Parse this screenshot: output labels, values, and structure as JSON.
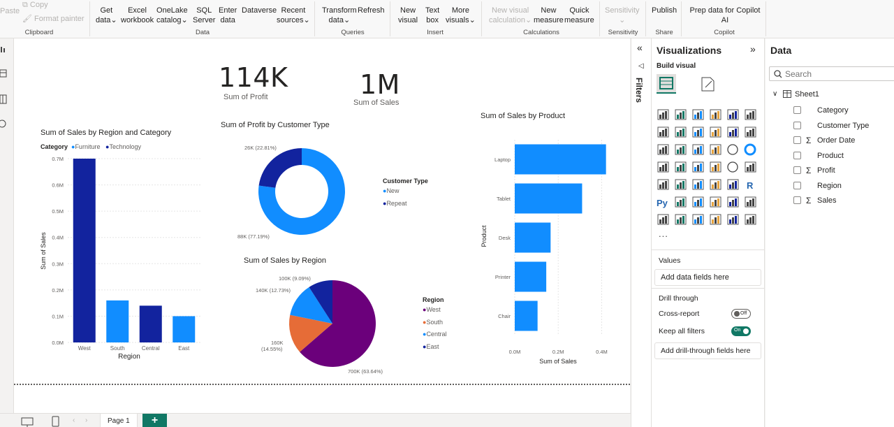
{
  "ribbon": {
    "clipboard": {
      "paste": "Paste",
      "copy": "Copy",
      "format_painter": "Format painter",
      "label": "Clipboard"
    },
    "data_group": {
      "get_data": [
        "Get",
        "data"
      ],
      "excel": [
        "Excel",
        "workbook"
      ],
      "onelake": [
        "OneLake",
        "catalog"
      ],
      "sql": [
        "SQL",
        "Server"
      ],
      "enter": [
        "Enter",
        "data"
      ],
      "dataverse": "Dataverse",
      "recent": [
        "Recent",
        "sources"
      ],
      "label": "Data"
    },
    "queries": {
      "transform": [
        "Transform",
        "data"
      ],
      "refresh": "Refresh",
      "label": "Queries"
    },
    "insert": {
      "new_visual": [
        "New",
        "visual"
      ],
      "text_box": [
        "Text",
        "box"
      ],
      "more_visuals": [
        "More",
        "visuals"
      ],
      "label": "Insert"
    },
    "calculations": {
      "new_visual_calc": [
        "New visual",
        "calculation"
      ],
      "new_measure": [
        "New",
        "measure"
      ],
      "quick_measure": [
        "Quick",
        "measure"
      ],
      "label": "Calculations"
    },
    "sensitivity": {
      "button": "Sensitivity",
      "label": "Sensitivity"
    },
    "share": {
      "publish": "Publish",
      "label": "Share"
    },
    "copilot": {
      "prep": [
        "Prep data for Copilot",
        "AI"
      ],
      "label": "Copilot"
    }
  },
  "cards": [
    {
      "value": "114K",
      "label": "Sum of Profit"
    },
    {
      "value": "1M",
      "label": "Sum of Sales"
    }
  ],
  "chart_data": [
    {
      "type": "bar",
      "title": "Sum of Sales by Region and Category",
      "legend_title": "Category",
      "legend": [
        "Furniture",
        "Technology"
      ],
      "categories": [
        "West",
        "South",
        "Central",
        "East"
      ],
      "series": [
        {
          "name": "Technology",
          "values": [
            0.7,
            0,
            0.14,
            0
          ]
        },
        {
          "name": "Furniture",
          "values": [
            0,
            0.16,
            0,
            0.1
          ]
        }
      ],
      "xlabel": "Region",
      "ylabel": "Sum of Sales",
      "yticks": [
        "0.0M",
        "0.1M",
        "0.2M",
        "0.3M",
        "0.4M",
        "0.5M",
        "0.6M",
        "0.7M"
      ],
      "ylim": [
        0,
        0.7
      ]
    },
    {
      "type": "pie",
      "title": "Sum of Profit by Customer Type",
      "legend_title": "Customer Type",
      "legend": [
        "New",
        "Repeat"
      ],
      "values": [
        88,
        26
      ],
      "labels": [
        "88K (77.19%)",
        "26K (22.81%)"
      ]
    },
    {
      "type": "pie",
      "title": "Sum of Sales by Region",
      "legend_title": "Region",
      "legend": [
        "West",
        "South",
        "Central",
        "East"
      ],
      "values": [
        700,
        160,
        140,
        100
      ],
      "labels": [
        "700K (63.64%)",
        "160K (14.55%)",
        "140K (12.73%)",
        "100K (9.09%)"
      ]
    },
    {
      "type": "bar",
      "title": "Sum of Sales by Product",
      "categories": [
        "Laptop",
        "Tablet",
        "Desk",
        "Printer",
        "Chair"
      ],
      "values": [
        0.42,
        0.31,
        0.165,
        0.145,
        0.105
      ],
      "xlabel": "Sum of Sales",
      "ylabel": "Product",
      "xticks": [
        "0.0M",
        "0.2M",
        "0.4M"
      ],
      "xlim": [
        0,
        0.45
      ]
    }
  ],
  "colors": {
    "technology": "#12239e",
    "furniture": "#118dff",
    "west": "#6b007b",
    "south": "#e66c37",
    "central": "#118dff",
    "east": "#12239e"
  },
  "filters": {
    "label": "Filters"
  },
  "visualizations": {
    "title": "Visualizations",
    "build_visual": "Build visual",
    "more": "...",
    "values_label": "Values",
    "add_data": "Add data fields here",
    "drill_through": "Drill through",
    "cross_report": "Cross-report",
    "cross_report_state": "Off",
    "keep_filters": "Keep all filters",
    "keep_filters_state": "On",
    "add_drill": "Add drill-through fields here"
  },
  "data_pane": {
    "title": "Data",
    "search_placeholder": "Search",
    "table": "Sheet1",
    "fields": [
      {
        "name": "Category",
        "sigma": false
      },
      {
        "name": "Customer Type",
        "sigma": false
      },
      {
        "name": "Order Date",
        "sigma": true
      },
      {
        "name": "Product",
        "sigma": false
      },
      {
        "name": "Profit",
        "sigma": true
      },
      {
        "name": "Region",
        "sigma": false
      },
      {
        "name": "Sales",
        "sigma": true
      }
    ]
  },
  "pages": {
    "current": "Page 1",
    "add": "+"
  }
}
